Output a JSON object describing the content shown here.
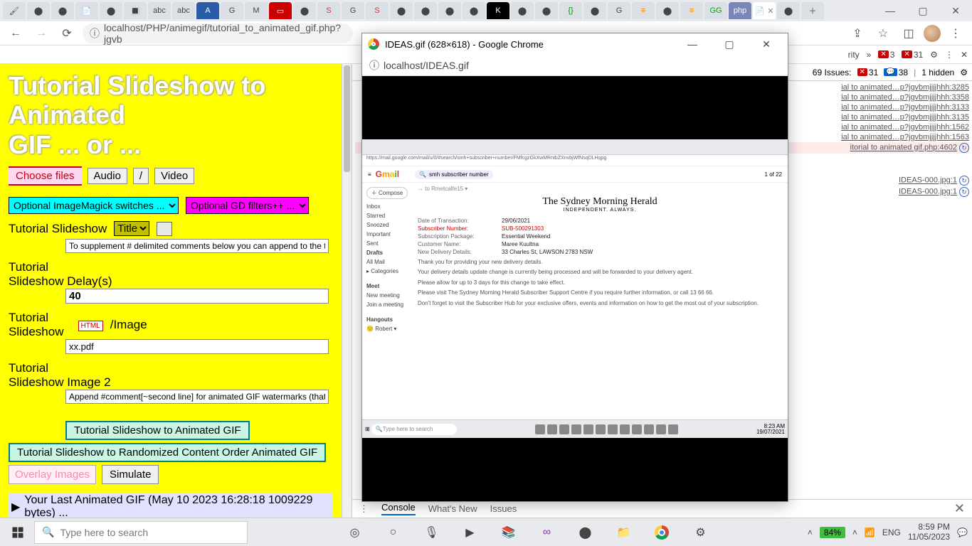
{
  "main_window": {
    "url": "localhost/PHP/animegif/tutorial_to_animated_gif.php?jgvb",
    "bookmarks_right": {
      "label": "rity"
    },
    "badges": {
      "red": "3",
      "redbox": "31"
    },
    "win_buttons": {
      "min": "—",
      "max": "▢",
      "close": "✕"
    }
  },
  "devtools": {
    "issues_label": "69 Issues:",
    "issues_red": "31",
    "issues_blue": "38",
    "hidden": "1 hidden",
    "lines": [
      "ial to animated…p?jgvbmjjjjhhh:3285",
      "ial to animated…p?jgvbmjjjjhhh:3358",
      "ial to animated…p?jgvbmjjjjhhh:3133",
      "ial to animated…p?jgvbmjjjjhhh:3135",
      "ial to animated…p?jgvbmjjjjhhh:1562",
      "ial to animated…p?jgvbmjjjjhhh:1563"
    ],
    "err_line": "itorial to animated gif.php:4602",
    "img_lines": [
      "IDEAS-000.jpg:1",
      "IDEAS-000.jpg:1"
    ],
    "tabs": {
      "console": "Console",
      "whatsnew": "What's New",
      "issues": "Issues"
    }
  },
  "page": {
    "title_a": "Tutorial Slideshow to Animated",
    "title_b": "GIF ... or ...",
    "choose": "Choose files",
    "audio": "Audio",
    "slash": "/",
    "video": "Video",
    "sel_im": "Optional ImageMagick switches ...",
    "sel_gd": "Optional GD filters++ ...",
    "lbl_ts": "Tutorial Slideshow",
    "sel_title": "Title",
    "hint1": "To supplement # delimited comments below you can append to the title # delimited (left,top)",
    "lbl_delay": "Tutorial\nSlideshow Delay(s)",
    "delay_val": "40",
    "lbl_html": "Tutorial\nSlideshow",
    "html_chip": "HTML",
    "slash_image": "/Image",
    "val_html": "xx.pdf",
    "lbl_img2": "Tutorial\nSlideshow Image 2",
    "hint2": "Append #comment[~second line] for animated GIF watermarks (that are red if first slide has",
    "btn_anim": "Tutorial Slideshow to Animated GIF",
    "btn_rand": "Tutorial Slideshow to Randomized Content Order Animated GIF",
    "btn_overlay": "Overlay Images",
    "btn_sim": "Simulate",
    "details": "Your Last Animated GIF (May 10 2023 16:28:18 1009229 bytes) ..."
  },
  "popup": {
    "title": "IDEAS.gif (628×618) - Google Chrome",
    "url": "localhost/IDEAS.gif",
    "gif": {
      "url": "https://mail.google.com/mail/u/0/#search/smh+subscriber+number/FMfcgzGkXwMRntbZXnvbjWfNsqDLHqpg",
      "search": "smh subscriber number",
      "compose": "Compose",
      "side": [
        "Inbox",
        "Starred",
        "Snoozed",
        "Important",
        "Sent",
        "Drafts",
        "All Mail",
        "Categories"
      ],
      "meet": "Meet",
      "meet_items": [
        "New meeting",
        "Join a meeting"
      ],
      "hangouts": "Hangouts",
      "hang_name": "Robert",
      "to": "to Rmetcalfe15",
      "smh_title": "The Sydney Morning Herald",
      "smh_sub": "INDEPENDENT. ALWAYS.",
      "kv": [
        {
          "k": "Date of Transaction:",
          "v": "29/06/2021"
        },
        {
          "k": "Subscriber Number:",
          "v": "SUB-500291303",
          "red": true
        },
        {
          "k": "Subscription Package:",
          "v": "Essential Weekend"
        },
        {
          "k": "Customer Name:",
          "v": "Maree Kuultna"
        },
        {
          "k": "New Delivery Details:",
          "v": "33 Charles St, LAWSON 2783 NSW"
        }
      ],
      "p1": "Thank you for providing your new delivery details.",
      "p2": "Your delivery details update change is currently being processed and will be forwarded to your delivery agent.",
      "p3": "Please allow for up to 3 days for this change to take effect.",
      "p4": "Please visit The Sydney Morning Herald Subscriber Support Centre if you require further information, or call 13 66 66.",
      "p5": "Don't forget to visit the Subscriber Hub for your exclusive offers, events and information on how to get the most out of your subscription.",
      "task_search": "Type here to search",
      "task_time": "8:23 AM",
      "task_date": "19/07/2021",
      "count": "1 of 22"
    }
  },
  "taskbar": {
    "search_placeholder": "Type here to search",
    "battery": "84%",
    "lang": "ENG",
    "time": "8:59 PM",
    "date": "11/05/2023"
  }
}
